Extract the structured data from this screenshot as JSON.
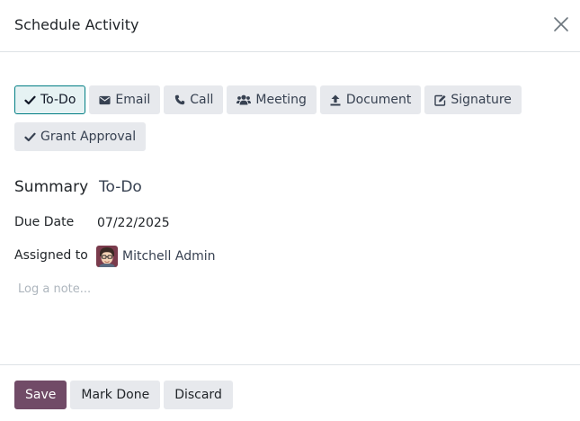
{
  "dialog": {
    "title": "Schedule Activity"
  },
  "activity_types": [
    {
      "label": "To-Do",
      "icon": "check-icon",
      "active": true
    },
    {
      "label": "Email",
      "icon": "envelope-icon",
      "active": false
    },
    {
      "label": "Call",
      "icon": "phone-icon",
      "active": false
    },
    {
      "label": "Meeting",
      "icon": "users-icon",
      "active": false
    },
    {
      "label": "Document",
      "icon": "upload-icon",
      "active": false
    },
    {
      "label": "Signature",
      "icon": "edit-icon",
      "active": false
    },
    {
      "label": "Grant Approval",
      "icon": "check-icon",
      "active": false
    }
  ],
  "form": {
    "summary_label": "Summary",
    "summary_value": "To-Do",
    "due_date_label": "Due Date",
    "due_date_value": "07/22/2025",
    "assigned_label": "Assigned to",
    "assigned_value": "Mitchell Admin",
    "note_placeholder": "Log a note..."
  },
  "footer": {
    "save_label": "Save",
    "mark_done_label": "Mark Done",
    "discard_label": "Discard"
  },
  "colors": {
    "primary": "#714b67",
    "active_border": "#017e84",
    "active_bg": "#e6f2f3",
    "button_bg": "#e7e9ed"
  }
}
